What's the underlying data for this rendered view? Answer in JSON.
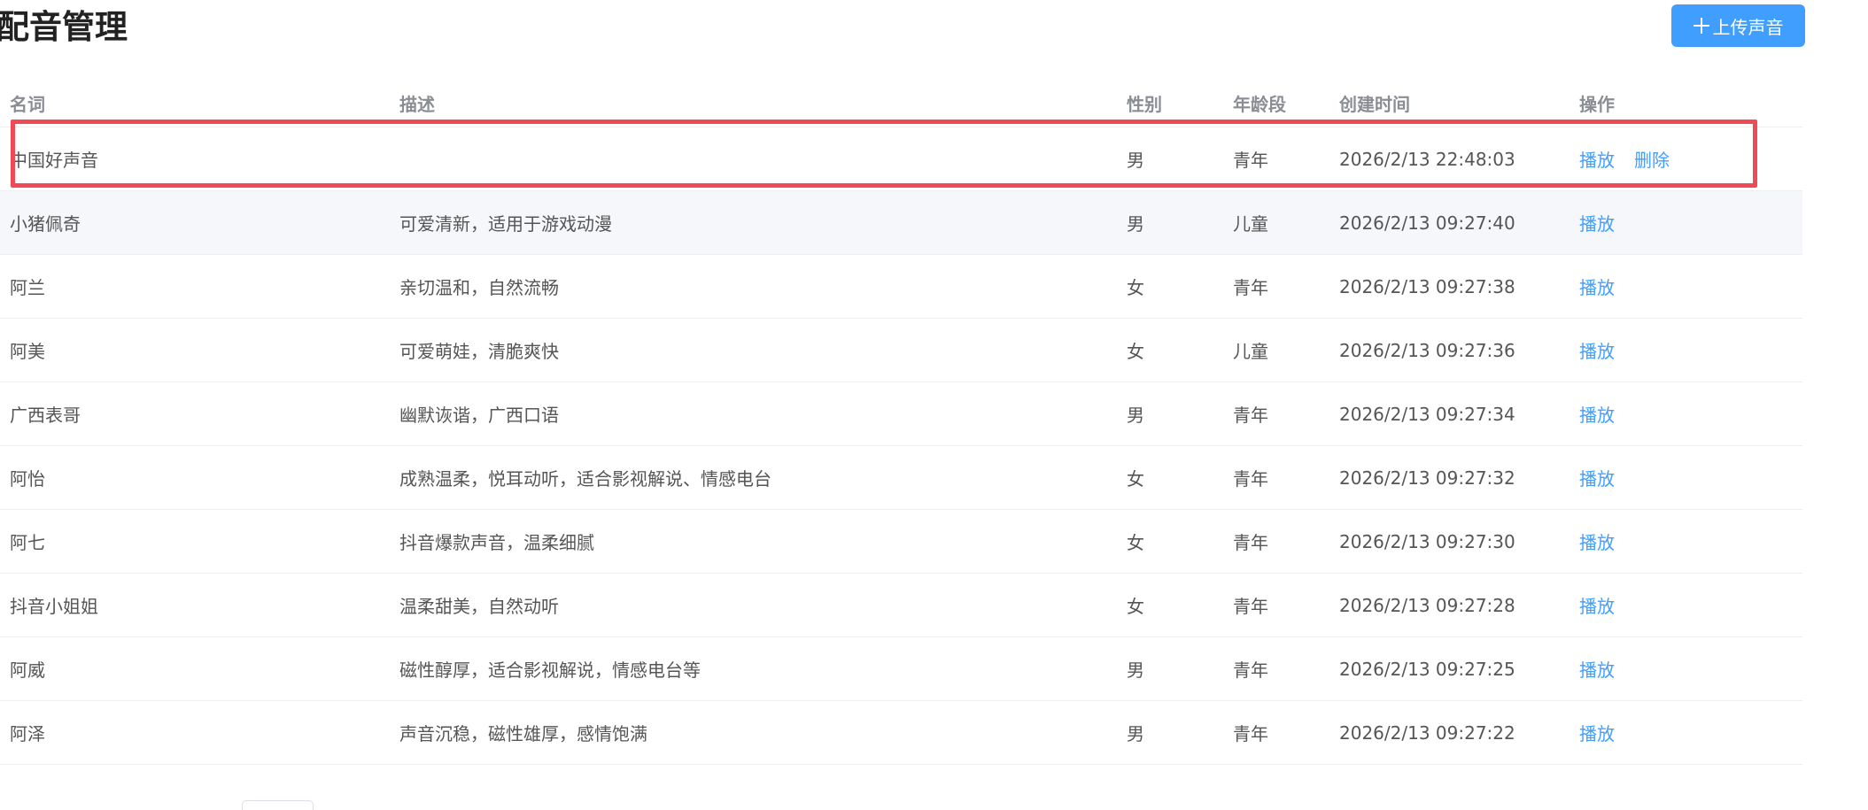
{
  "header": {
    "title": "配音管理",
    "upload_button_label": "上传声音",
    "upload_icon": "plus-icon"
  },
  "table": {
    "columns": [
      "名词",
      "描述",
      "性别",
      "年龄段",
      "创建时间",
      "操作"
    ],
    "rows": [
      {
        "name": "中国好声音",
        "description": "",
        "gender": "男",
        "age": "青年",
        "created": "2026/2/13 22:48:03",
        "actions": [
          "播放",
          "删除"
        ]
      },
      {
        "name": "小猪佩奇",
        "description": "可爱清新，适用于游戏动漫",
        "gender": "男",
        "age": "儿童",
        "created": "2026/2/13 09:27:40",
        "actions": [
          "播放"
        ]
      },
      {
        "name": "阿兰",
        "description": "亲切温和，自然流畅",
        "gender": "女",
        "age": "青年",
        "created": "2026/2/13 09:27:38",
        "actions": [
          "播放"
        ]
      },
      {
        "name": "阿美",
        "description": "可爱萌娃，清脆爽快",
        "gender": "女",
        "age": "儿童",
        "created": "2026/2/13 09:27:36",
        "actions": [
          "播放"
        ]
      },
      {
        "name": "广西表哥",
        "description": "幽默诙谐，广西口语",
        "gender": "男",
        "age": "青年",
        "created": "2026/2/13 09:27:34",
        "actions": [
          "播放"
        ]
      },
      {
        "name": "阿怡",
        "description": "成熟温柔，悦耳动听，适合影视解说、情感电台",
        "gender": "女",
        "age": "青年",
        "created": "2026/2/13 09:27:32",
        "actions": [
          "播放"
        ]
      },
      {
        "name": "阿七",
        "description": "抖音爆款声音，温柔细腻",
        "gender": "女",
        "age": "青年",
        "created": "2026/2/13 09:27:30",
        "actions": [
          "播放"
        ]
      },
      {
        "name": "抖音小姐姐",
        "description": "温柔甜美，自然动听",
        "gender": "女",
        "age": "青年",
        "created": "2026/2/13 09:27:28",
        "actions": [
          "播放"
        ]
      },
      {
        "name": "阿威",
        "description": "磁性醇厚，适合影视解说，情感电台等",
        "gender": "男",
        "age": "青年",
        "created": "2026/2/13 09:27:25",
        "actions": [
          "播放"
        ]
      },
      {
        "name": "阿泽",
        "description": "声音沉稳，磁性雄厚，感情饱满",
        "gender": "男",
        "age": "青年",
        "created": "2026/2/13 09:27:22",
        "actions": [
          "播放"
        ]
      }
    ]
  },
  "colors": {
    "accent": "#409eff",
    "highlight_border": "#f04b55",
    "striped_row": "#f5f7fa"
  }
}
